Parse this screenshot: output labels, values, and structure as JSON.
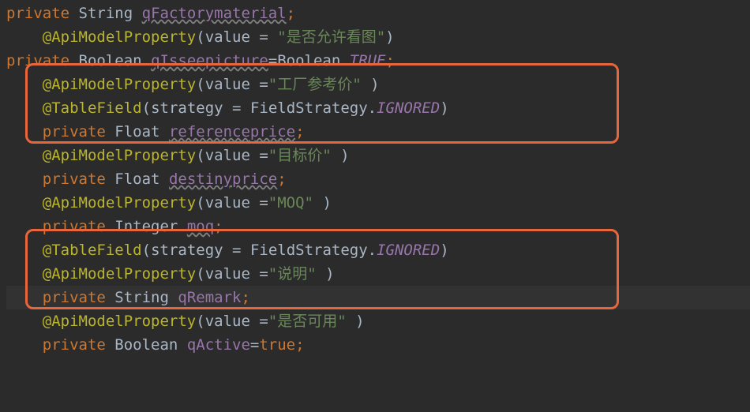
{
  "code": {
    "lines": [
      {
        "indent": 0,
        "tokens": [
          {
            "t": "keyword",
            "v": "private"
          },
          {
            "t": "space",
            "v": " "
          },
          {
            "t": "type",
            "v": "String"
          },
          {
            "t": "space",
            "v": " "
          },
          {
            "t": "field-underline",
            "v": "qFactorymaterial"
          },
          {
            "t": "semicolon",
            "v": ";"
          }
        ]
      },
      {
        "indent": 1,
        "tokens": [
          {
            "t": "annotation",
            "v": "@ApiModelProperty"
          },
          {
            "t": "paren",
            "v": "("
          },
          {
            "t": "type",
            "v": "value"
          },
          {
            "t": "space",
            "v": " "
          },
          {
            "t": "equals",
            "v": "="
          },
          {
            "t": "space",
            "v": " "
          },
          {
            "t": "string",
            "v": "\"是否允许看图\""
          },
          {
            "t": "paren",
            "v": ")"
          }
        ]
      },
      {
        "indent": 0,
        "tokens": [
          {
            "t": "keyword",
            "v": "private"
          },
          {
            "t": "space",
            "v": " "
          },
          {
            "t": "type",
            "v": "Boolean"
          },
          {
            "t": "space",
            "v": " "
          },
          {
            "t": "field-underline",
            "v": "qIsseepicture"
          },
          {
            "t": "equals",
            "v": "="
          },
          {
            "t": "type",
            "v": "Boolean"
          },
          {
            "t": "dot",
            "v": "."
          },
          {
            "t": "static-italic",
            "v": "TRUE"
          },
          {
            "t": "semicolon",
            "v": ";"
          }
        ]
      },
      {
        "indent": 1,
        "tokens": [
          {
            "t": "annotation",
            "v": "@ApiModelProperty"
          },
          {
            "t": "paren",
            "v": "("
          },
          {
            "t": "type",
            "v": "value"
          },
          {
            "t": "space",
            "v": " "
          },
          {
            "t": "equals",
            "v": "="
          },
          {
            "t": "string",
            "v": "\"工厂参考价\""
          },
          {
            "t": "space",
            "v": " "
          },
          {
            "t": "paren",
            "v": ")"
          }
        ]
      },
      {
        "indent": 1,
        "tokens": [
          {
            "t": "annotation",
            "v": "@TableField"
          },
          {
            "t": "paren",
            "v": "("
          },
          {
            "t": "type",
            "v": "strategy"
          },
          {
            "t": "space",
            "v": " "
          },
          {
            "t": "equals",
            "v": "="
          },
          {
            "t": "space",
            "v": " "
          },
          {
            "t": "type",
            "v": "FieldStrategy"
          },
          {
            "t": "dot",
            "v": "."
          },
          {
            "t": "static-italic",
            "v": "IGNORED"
          },
          {
            "t": "paren",
            "v": ")"
          }
        ]
      },
      {
        "indent": 1,
        "tokens": [
          {
            "t": "keyword",
            "v": "private"
          },
          {
            "t": "space",
            "v": " "
          },
          {
            "t": "type",
            "v": "Float"
          },
          {
            "t": "space",
            "v": " "
          },
          {
            "t": "field-underline",
            "v": "referenceprice"
          },
          {
            "t": "semicolon",
            "v": ";"
          }
        ]
      },
      {
        "indent": 1,
        "tokens": [
          {
            "t": "annotation",
            "v": "@ApiModelProperty"
          },
          {
            "t": "paren",
            "v": "("
          },
          {
            "t": "type",
            "v": "value"
          },
          {
            "t": "space",
            "v": " "
          },
          {
            "t": "equals",
            "v": "="
          },
          {
            "t": "string",
            "v": "\"目标价\""
          },
          {
            "t": "space",
            "v": " "
          },
          {
            "t": "paren",
            "v": ")"
          }
        ]
      },
      {
        "indent": 1,
        "tokens": [
          {
            "t": "keyword",
            "v": "private"
          },
          {
            "t": "space",
            "v": " "
          },
          {
            "t": "type",
            "v": "Float"
          },
          {
            "t": "space",
            "v": " "
          },
          {
            "t": "field-underline",
            "v": "destinyprice"
          },
          {
            "t": "semicolon",
            "v": ";"
          }
        ]
      },
      {
        "indent": 1,
        "tokens": [
          {
            "t": "annotation",
            "v": "@ApiModelProperty"
          },
          {
            "t": "paren",
            "v": "("
          },
          {
            "t": "type",
            "v": "value"
          },
          {
            "t": "space",
            "v": " "
          },
          {
            "t": "equals",
            "v": "="
          },
          {
            "t": "string",
            "v": "\"MOQ\""
          },
          {
            "t": "space",
            "v": " "
          },
          {
            "t": "paren",
            "v": ")"
          }
        ]
      },
      {
        "indent": 1,
        "tokens": [
          {
            "t": "keyword",
            "v": "private"
          },
          {
            "t": "space",
            "v": " "
          },
          {
            "t": "type",
            "v": "Integer"
          },
          {
            "t": "space",
            "v": " "
          },
          {
            "t": "field-underline",
            "v": "moq"
          },
          {
            "t": "semicolon",
            "v": ";"
          }
        ]
      },
      {
        "indent": 1,
        "tokens": [
          {
            "t": "annotation",
            "v": "@TableField"
          },
          {
            "t": "paren",
            "v": "("
          },
          {
            "t": "type",
            "v": "strategy"
          },
          {
            "t": "space",
            "v": " "
          },
          {
            "t": "equals",
            "v": "="
          },
          {
            "t": "space",
            "v": " "
          },
          {
            "t": "type",
            "v": "FieldStrategy"
          },
          {
            "t": "dot",
            "v": "."
          },
          {
            "t": "static-italic",
            "v": "IGNORED"
          },
          {
            "t": "paren",
            "v": ")"
          }
        ]
      },
      {
        "indent": 1,
        "tokens": [
          {
            "t": "annotation",
            "v": "@ApiModelProperty"
          },
          {
            "t": "paren",
            "v": "("
          },
          {
            "t": "type",
            "v": "value"
          },
          {
            "t": "space",
            "v": " "
          },
          {
            "t": "equals",
            "v": "="
          },
          {
            "t": "string",
            "v": "\"说明\""
          },
          {
            "t": "space",
            "v": " "
          },
          {
            "t": "paren",
            "v": ")"
          }
        ]
      },
      {
        "indent": 1,
        "caret": true,
        "tokens": [
          {
            "t": "keyword",
            "v": "private"
          },
          {
            "t": "space",
            "v": " "
          },
          {
            "t": "type",
            "v": "String"
          },
          {
            "t": "space",
            "v": " "
          },
          {
            "t": "field",
            "v": "qRemark"
          },
          {
            "t": "semicolon",
            "v": ";"
          }
        ]
      },
      {
        "indent": 1,
        "tokens": [
          {
            "t": "annotation",
            "v": "@ApiModelProperty"
          },
          {
            "t": "paren",
            "v": "("
          },
          {
            "t": "type",
            "v": "value"
          },
          {
            "t": "space",
            "v": " "
          },
          {
            "t": "equals",
            "v": "="
          },
          {
            "t": "string",
            "v": "\"是否可用\""
          },
          {
            "t": "space",
            "v": " "
          },
          {
            "t": "paren",
            "v": ")"
          }
        ]
      },
      {
        "indent": 1,
        "tokens": [
          {
            "t": "keyword",
            "v": "private"
          },
          {
            "t": "space",
            "v": " "
          },
          {
            "t": "type",
            "v": "Boolean"
          },
          {
            "t": "space",
            "v": " "
          },
          {
            "t": "field",
            "v": "qActive"
          },
          {
            "t": "equals",
            "v": "="
          },
          {
            "t": "keyword",
            "v": "true"
          },
          {
            "t": "semicolon",
            "v": ";"
          }
        ]
      }
    ]
  }
}
